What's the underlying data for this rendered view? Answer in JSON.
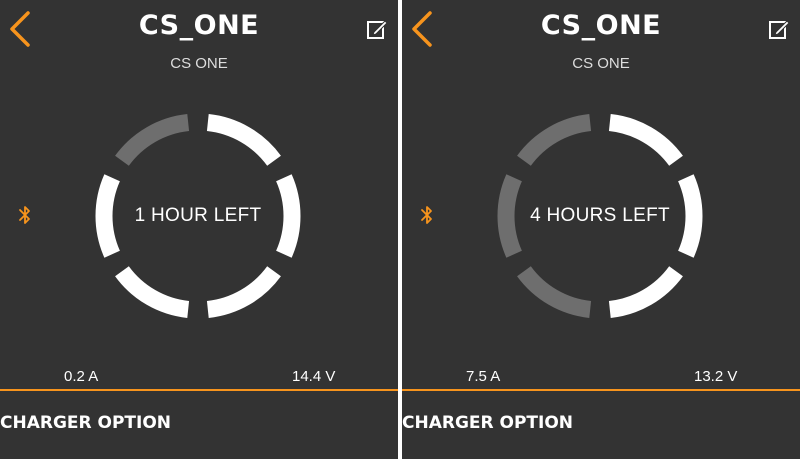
{
  "colors": {
    "background": "#333333",
    "accent": "#f7941d",
    "segment_on": "#ffffff",
    "segment_off": "#6e6e6e"
  },
  "icons": {
    "back": "chevron-left-icon",
    "edit": "edit-icon",
    "bluetooth": "bluetooth-icon"
  },
  "screens": [
    {
      "title": "CS_ONE",
      "subtitle": "CS ONE",
      "status_text": "1 HOUR LEFT",
      "current": "0.2 A",
      "voltage": "14.4 V",
      "charger_option_label": "CHARGER OPTION",
      "ring_segments_total": 6,
      "ring_segments_filled": 5
    },
    {
      "title": "CS_ONE",
      "subtitle": "CS ONE",
      "status_text": "4 HOURS LEFT",
      "current": "7.5 A",
      "voltage": "13.2 V",
      "charger_option_label": "CHARGER OPTION",
      "ring_segments_total": 6,
      "ring_segments_filled": 3
    }
  ]
}
